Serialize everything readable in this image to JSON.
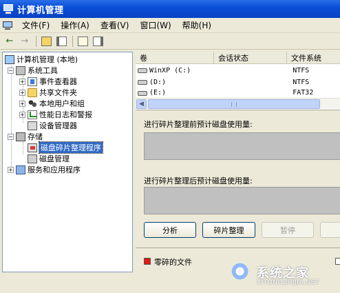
{
  "window": {
    "title": "计算机管理"
  },
  "menu": [
    {
      "id": "file",
      "label": "文件(F)"
    },
    {
      "id": "action",
      "label": "操作(A)"
    },
    {
      "id": "view",
      "label": "查看(V)"
    },
    {
      "id": "window",
      "label": "窗口(W)"
    },
    {
      "id": "help",
      "label": "帮助(H)"
    }
  ],
  "tree": {
    "root": "计算机管理 (本地)",
    "system_tools": "系统工具",
    "event_viewer": "事件查看器",
    "shared_folders": "共享文件夹",
    "local_users": "本地用户和组",
    "perf_logs": "性能日志和警报",
    "device_manager": "设备管理器",
    "storage": "存储",
    "disk_defrag": "磁盘碎片整理程序",
    "disk_management": "磁盘管理",
    "services_apps": "服务和应用程序"
  },
  "volumes": {
    "headers": {
      "volume": "卷",
      "session_status": "会话状态",
      "file_system": "文件系统"
    },
    "rows": [
      {
        "name": "WinXP (C:)",
        "fs": "NTFS"
      },
      {
        "name": "(D:)",
        "fs": "NTFS"
      },
      {
        "name": "(E:)",
        "fs": "FAT32"
      }
    ]
  },
  "defrag": {
    "before_label": "进行碎片整理前预计磁盘使用量:",
    "after_label": "进行碎片整理后预计磁盘使用量:",
    "analyze_button": "分析",
    "defrag_button": "碎片整理",
    "pause_button": "暂停",
    "legend_fragmented": "零碎的文件",
    "legend_fragmented_color": "#e01818"
  },
  "watermark": {
    "text": "系统之家",
    "url": "XITONGZHIJIA.NET"
  }
}
